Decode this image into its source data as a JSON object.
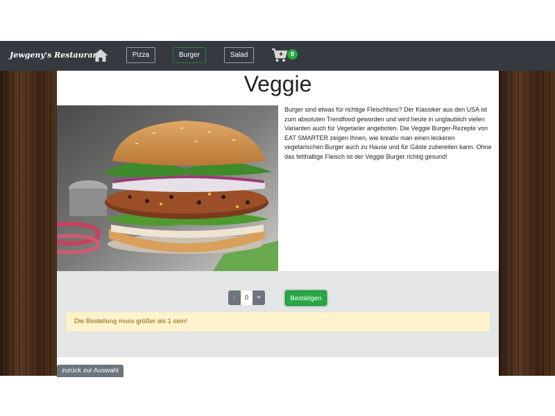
{
  "navbar": {
    "brand": "Jewgeny's Restaurant",
    "home_icon": "home-icon",
    "items": [
      {
        "label": "Pizza",
        "active": false
      },
      {
        "label": "Burger",
        "active": true
      },
      {
        "label": "Salad",
        "active": false
      }
    ],
    "cart_icon": "cart-icon",
    "cart_count": "0",
    "colors": {
      "bar": "#343a40",
      "badge": "#28a745"
    }
  },
  "product": {
    "title": "Veggie",
    "image": "veggie-burger-photo",
    "description": "Burger sind etwas für richtige Fleischfans? Der Klassiker aus den USA ist zum absoluten Trendfood geworden und wird heute in unglaublich vielen Varianten auch für Vegetarier angeboten. Die Veggie Burger-Rezepte von EAT SMARTER zeigen Ihnen, wie kreativ man einen leckeren vegetarischen Burger auch zu Hause und für Gäste zubereiten kann. Ohne das fetthaltige Fleisch ist der Veggie Burger richtig gesund!"
  },
  "order": {
    "minus_label": "-",
    "quantity": "0",
    "plus_label": "+",
    "confirm_label": "Bestätigen",
    "alert": "Die Bestellung muss größer als 1 sein!",
    "colors": {
      "confirm": "#28a745",
      "alert_bg": "#fff3cd",
      "alert_text": "#856404"
    }
  },
  "back_label": "zurück zur Auswahl"
}
